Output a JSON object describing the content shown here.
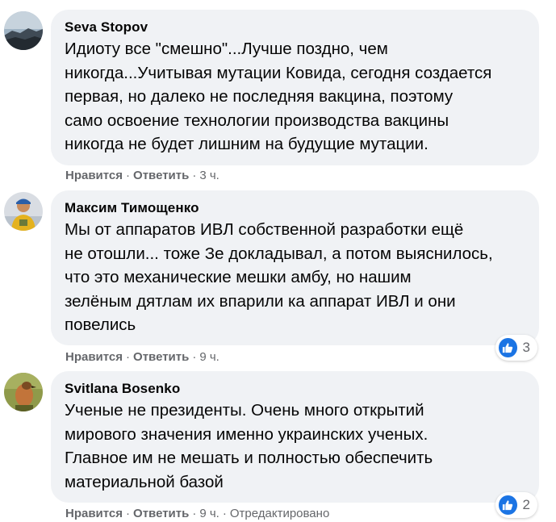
{
  "comments": [
    {
      "author": "Seva Stopov",
      "text": "Идиоту все \"смешно\"...Лучше поздно, чем\nникогда...Учитывая мутации Ковида, сегодня создается\nпервая, но далеко не последняя вакцина, поэтому\nсамо освоение технологии производства вакцины\nникогда не будет лишним на будущие мутации.",
      "like_label": "Нравится",
      "reply_label": "Ответить",
      "time": "3 ч.",
      "avatar_icon": "landscape-avatar"
    },
    {
      "author": "Максим Тимощенко",
      "text": "Мы от аппаратов ИВЛ собственной разработки ещё\nне отошли... тоже Зе докладывал, а потом выяснилось,\nчто это механические мешки амбу, но нашим\nзелёным дятлам их впарили ка аппарат ИВЛ и они\nповелись",
      "like_label": "Нравится",
      "reply_label": "Ответить",
      "time": "9 ч.",
      "reaction_count": "3",
      "avatar_icon": "person-avatar"
    },
    {
      "author": "Svitlana Bosenko",
      "text": "Ученые не президенты. Очень много открытий\nмирового значения именно украинских ученых.\nГлавное им не мешать и полностью обеспечить\nматериальной базой",
      "like_label": "Нравится",
      "reply_label": "Ответить",
      "time": "9 ч.",
      "edited_label": "Отредактировано",
      "reaction_count": "2",
      "avatar_icon": "bird-avatar"
    }
  ],
  "colors": {
    "bubble": "#f0f2f5",
    "text": "#050505",
    "meta": "#65676b",
    "like_blue": "#1b74e4"
  },
  "icons": {
    "reaction": "like-thumb-icon"
  }
}
